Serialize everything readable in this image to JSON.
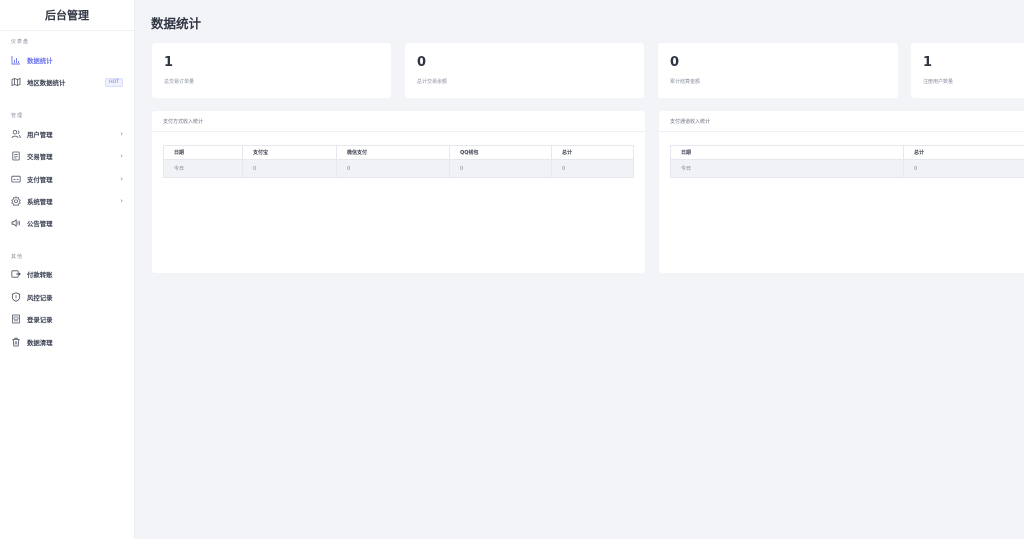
{
  "sidebar": {
    "brand": "后台管理",
    "groups": [
      {
        "title": "仪表盘"
      },
      {
        "title": "管理"
      },
      {
        "title": "其他"
      }
    ],
    "items": [
      {
        "label": "数据统计",
        "icon": "bar-chart-icon",
        "active": true
      },
      {
        "label": "地区数据统计",
        "icon": "map-icon",
        "badge": "HOT"
      },
      {
        "label": "用户管理",
        "icon": "users-icon",
        "arrow": "›"
      },
      {
        "label": "交易管理",
        "icon": "document-icon",
        "arrow": "›"
      },
      {
        "label": "支付管理",
        "icon": "card-icon",
        "arrow": "›"
      },
      {
        "label": "系统管理",
        "icon": "gear-icon",
        "arrow": "›"
      },
      {
        "label": "公告管理",
        "icon": "speaker-icon"
      },
      {
        "label": "付款转账",
        "icon": "transfer-icon"
      },
      {
        "label": "风控记录",
        "icon": "shield-icon"
      },
      {
        "label": "登录记录",
        "icon": "log-icon"
      },
      {
        "label": "数据清理",
        "icon": "trash-icon"
      }
    ]
  },
  "header": {
    "title": "数据统计"
  },
  "stats": [
    {
      "value": "1",
      "label": "总交易订单量"
    },
    {
      "value": "0",
      "label": "总计交易余额"
    },
    {
      "value": "0",
      "label": "累计结算金额"
    },
    {
      "value": "1",
      "label": "注册用户数量"
    }
  ],
  "panels": [
    {
      "title": "支付方式收入统计",
      "columns": [
        "日期",
        "支付宝",
        "微信支付",
        "QQ钱包",
        "总计"
      ],
      "rows": [
        [
          "今日",
          "0",
          "0",
          "0",
          "0"
        ]
      ]
    },
    {
      "title": "支付通道收入统计",
      "columns": [
        "日期",
        "总计"
      ],
      "rows": [
        [
          "今日",
          "0"
        ]
      ]
    }
  ],
  "colors": {
    "accent": "#6b74ee",
    "background": "#f3f4f8",
    "card": "#ffffff"
  }
}
